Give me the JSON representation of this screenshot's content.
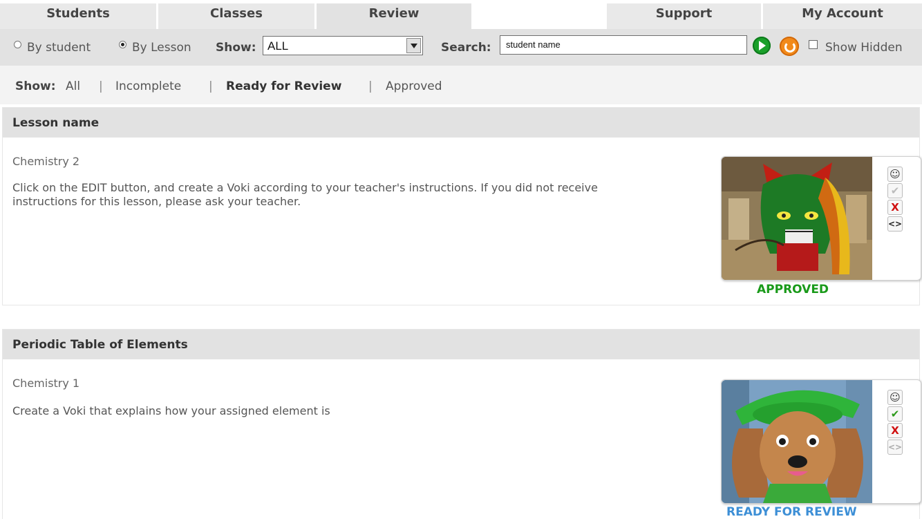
{
  "tabs": [
    {
      "label": "Students"
    },
    {
      "label": "Classes"
    },
    {
      "label": "Review",
      "active": true
    },
    {
      "label": "Support"
    },
    {
      "label": "My Account"
    }
  ],
  "toolbar": {
    "radio_by_student": "By student",
    "radio_by_lesson": "By Lesson",
    "selected_view": "By Lesson",
    "show_label": "Show:",
    "show_value": "ALL",
    "search_label": "Search:",
    "search_value": "student name",
    "show_hidden_label": "Show Hidden",
    "show_hidden_checked": false
  },
  "filter": {
    "label": "Show:",
    "options": [
      {
        "label": "All"
      },
      {
        "label": "Incomplete"
      },
      {
        "label": "Ready for Review",
        "active": true
      },
      {
        "label": "Approved"
      }
    ]
  },
  "lessons": [
    {
      "title": "Lesson name",
      "subject": "Chemistry 2",
      "description": "Click on the EDIT button, and create a Voki according to your teacher's instructions. If you did not receive instructions for this lesson, please ask your teacher.",
      "status": "APPROVED",
      "status_color": "#1a9a1a",
      "avatar": "dragon-avatar"
    },
    {
      "title": "Periodic Table of Elements",
      "subject": "Chemistry 1",
      "description": "Create a Voki that explains how your assigned element is",
      "status": "READY FOR REVIEW",
      "status_color": "#3d8fd6",
      "avatar": "dog-avatar"
    }
  ],
  "icons": {
    "student": "person-icon",
    "approve": "check-icon",
    "reject": "x-icon",
    "embed": "code-icon"
  }
}
